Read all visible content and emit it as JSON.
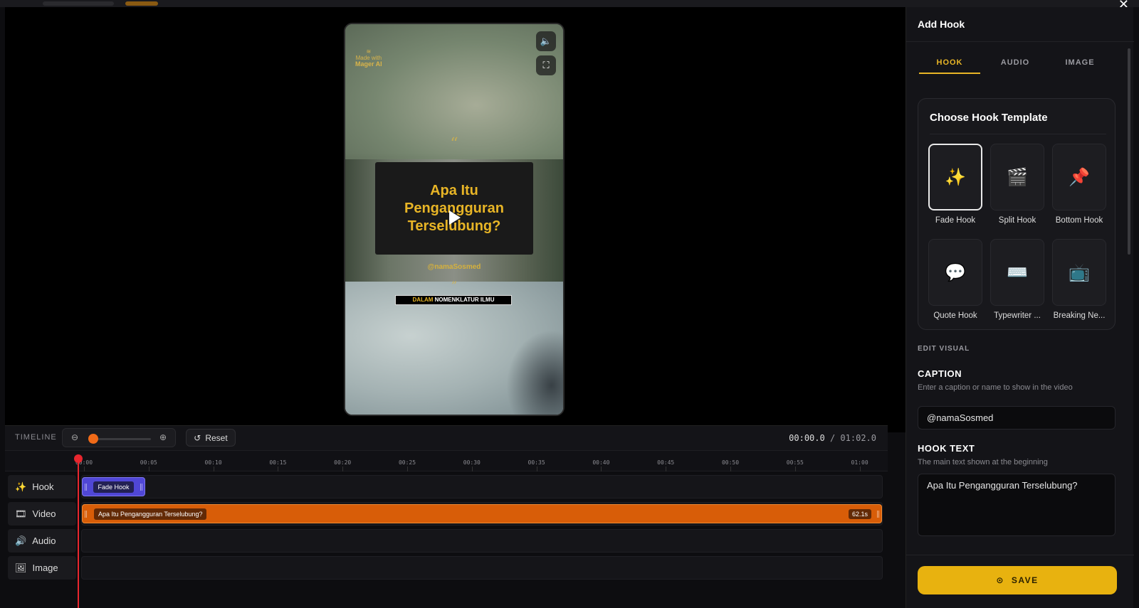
{
  "panel": {
    "title": "Add Hook",
    "tabs": [
      {
        "label": "HOOK",
        "active": true
      },
      {
        "label": "AUDIO",
        "active": false
      },
      {
        "label": "IMAGE",
        "active": false
      }
    ],
    "template_section_title": "Choose Hook Template",
    "templates": [
      {
        "name": "Fade Hook",
        "icon": "sparkles-icon",
        "glyph": "✨",
        "selected": true
      },
      {
        "name": "Split Hook",
        "icon": "clapperboard-icon",
        "glyph": "🎬",
        "selected": false
      },
      {
        "name": "Bottom Hook",
        "icon": "pushpin-icon",
        "glyph": "📌",
        "selected": false
      },
      {
        "name": "Quote Hook",
        "icon": "speech-bubble-icon",
        "glyph": "💬",
        "selected": false
      },
      {
        "name": "Typewriter ...",
        "icon": "keyboard-icon",
        "glyph": "⌨️",
        "selected": false
      },
      {
        "name": "Breaking Ne...",
        "icon": "television-icon",
        "glyph": "📺",
        "selected": false
      }
    ],
    "edit_visual_label": "EDIT VISUAL",
    "caption": {
      "title": "CAPTION",
      "hint": "Enter a caption or name to show in the video",
      "value": "@namaSosmed"
    },
    "hook_text": {
      "title": "HOOK TEXT",
      "hint": "The main text shown at the beginning",
      "value": "Apa Itu Pengangguran Terselubung?"
    },
    "save_label": "SAVE"
  },
  "preview": {
    "watermark_line1": "Made with",
    "watermark_line2": "Mager AI",
    "quote_open": "“",
    "quote_close": "”",
    "hook_text": "Apa Itu Pengangguran Terselubung?",
    "handle": "@namaSosmed",
    "subtitle_highlight": "DALAM",
    "subtitle_rest": "NOMENKLATUR ILMU"
  },
  "timeline": {
    "label": "TIMELINE",
    "reset_label": "Reset",
    "current_time": "00:00.0",
    "separator": "/",
    "total_time": "01:02.0",
    "zoom_level_fraction": 0.0,
    "ticks": [
      "00:00",
      "00:05",
      "00:10",
      "00:15",
      "00:20",
      "00:25",
      "00:30",
      "00:35",
      "00:40",
      "00:45",
      "00:50",
      "00:55",
      "01:00"
    ],
    "tracks": [
      {
        "name": "Hook",
        "icon": "sparkles-icon",
        "glyph": "✨"
      },
      {
        "name": "Video",
        "icon": "film-icon",
        "glyph": "🎞"
      },
      {
        "name": "Audio",
        "icon": "speaker-icon",
        "glyph": "🔊"
      },
      {
        "name": "Image",
        "icon": "image-icon",
        "glyph": "🖼"
      }
    ],
    "hook_clip_label": "Fade Hook",
    "video_clip_label": "Apa Itu Pengangguran Terselubung?",
    "video_clip_duration": "62.1s"
  },
  "colors": {
    "accent": "#e8b526",
    "playhead": "#e8262e",
    "video_clip": "#d85d08",
    "hook_clip": "#5047d6"
  }
}
